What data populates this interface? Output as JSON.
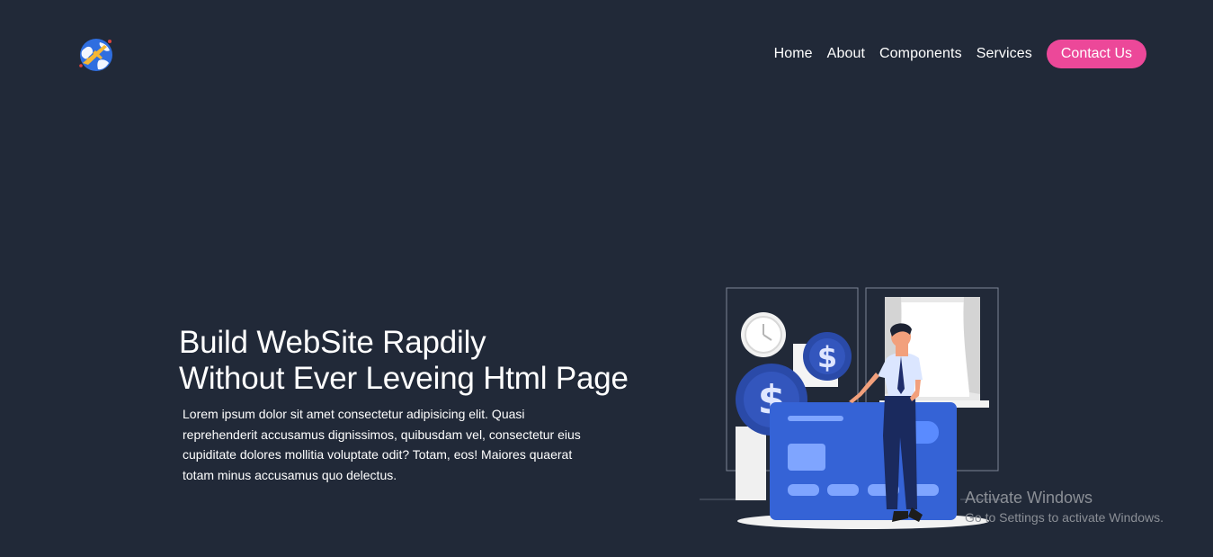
{
  "header": {
    "logo_icon": "globe-airplane-icon",
    "nav": {
      "home": "Home",
      "about": "About",
      "components": "Components",
      "services": "Services",
      "contact": "Contact Us"
    }
  },
  "hero": {
    "title_line1": "Build WebSite Rapdily",
    "title_line2": "Without Ever Leveing Html Page",
    "description": "Lorem ipsum dolor sit amet consectetur adipisicing elit. Quasi reprehenderit accusamus dignissimos, quibusdam vel, consectetur eius cupiditate dolores mollitia voluptate odit? Totam, eos! Maiores quaerat totam minus accusamus quo delectus.",
    "illustration": "credit-card-man-illustration"
  },
  "watermark": {
    "title": "Activate Windows",
    "subtitle": "Go to Settings to activate Windows."
  },
  "colors": {
    "background": "#212938",
    "accent": "#ec4899",
    "card_blue": "#3563d6",
    "coin_blue": "#2a4aa8"
  }
}
